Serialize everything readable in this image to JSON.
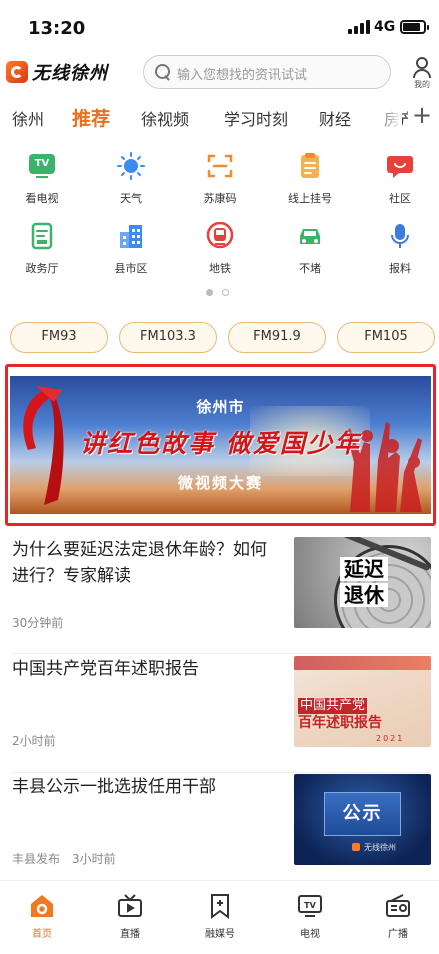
{
  "status_bar": {
    "time": "13:20",
    "network": "4G"
  },
  "header": {
    "logo_text": "无线徐州",
    "search_placeholder": "输入您想找的资讯试试",
    "mine_label": "我的"
  },
  "channel_tabs": [
    {
      "label": "徐州",
      "active": false
    },
    {
      "label": "推荐",
      "active": true
    },
    {
      "label": "徐视频",
      "active": false
    },
    {
      "label": "学习时刻",
      "active": false
    },
    {
      "label": "财经",
      "active": false
    },
    {
      "label": "房产",
      "active": false
    }
  ],
  "services": [
    {
      "label": "看电视",
      "icon": "tv-icon",
      "color": "#3bb36b"
    },
    {
      "label": "天气",
      "icon": "sun-icon",
      "color": "#3c8cf0"
    },
    {
      "label": "苏康码",
      "icon": "scan-icon",
      "color": "#f08a2c"
    },
    {
      "label": "线上挂号",
      "icon": "clipboard-icon",
      "color": "#f09a2c"
    },
    {
      "label": "社区",
      "icon": "chat-icon",
      "color": "#e8403a"
    },
    {
      "label": "政务厅",
      "icon": "document-icon",
      "color": "#3bb36b"
    },
    {
      "label": "县市区",
      "icon": "building-icon",
      "color": "#3c8cf0"
    },
    {
      "label": "地铁",
      "icon": "metro-icon",
      "color": "#e8403a"
    },
    {
      "label": "不堵",
      "icon": "car-icon",
      "color": "#3bb36b"
    },
    {
      "label": "报料",
      "icon": "microphone-icon",
      "color": "#3c7ce0"
    }
  ],
  "fm_stations": [
    "FM93",
    "FM103.3",
    "FM91.9",
    "FM105"
  ],
  "banner": {
    "line1": "徐州市",
    "line2": "讲红色故事 做爱国少年",
    "line3": "微视频大赛"
  },
  "news": [
    {
      "title": "为什么要延迟法定退休年龄？如何进行？专家解读",
      "source": "",
      "time": "30分钟前",
      "thumb_text": [
        "延迟",
        "退休"
      ]
    },
    {
      "title": "中国共产党百年述职报告",
      "source": "",
      "time": "2小时前",
      "thumb_text": [
        "中国共产党",
        "百年述职报告",
        "2021"
      ]
    },
    {
      "title": "丰县公示一批选拔任用干部",
      "source": "丰县发布",
      "time": "3小时前",
      "thumb_text": [
        "公示",
        "无线徐州"
      ]
    }
  ],
  "bottom_nav": [
    {
      "label": "首页",
      "icon": "home-icon",
      "active": true
    },
    {
      "label": "直播",
      "icon": "live-icon",
      "active": false
    },
    {
      "label": "融媒号",
      "icon": "bookmark-plus-icon",
      "active": false
    },
    {
      "label": "电视",
      "icon": "tv-screen-icon",
      "active": false
    },
    {
      "label": "广播",
      "icon": "radio-icon",
      "active": false
    }
  ],
  "colors": {
    "accent": "#e8711c",
    "banner_border": "#e5272a"
  }
}
